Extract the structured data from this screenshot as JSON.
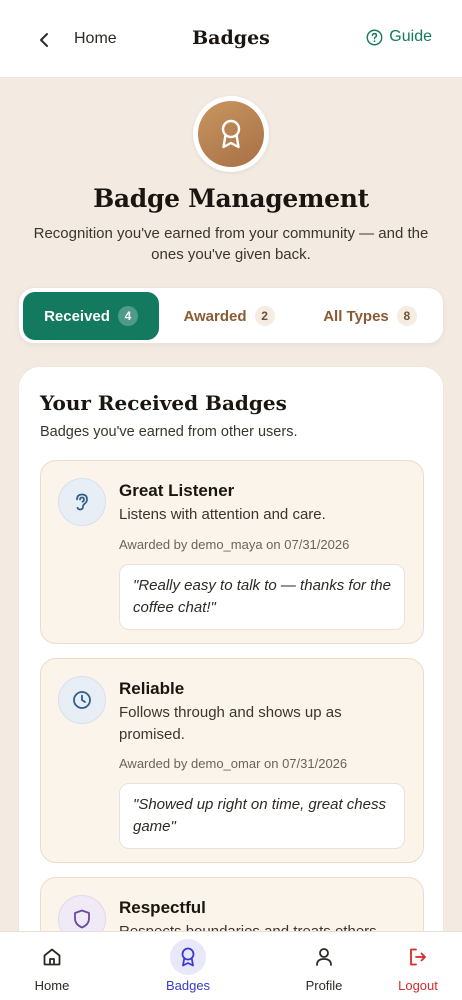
{
  "header": {
    "back_label": "Home",
    "title": "Badges",
    "guide_label": "Guide"
  },
  "hero": {
    "title": "Badge Management",
    "subtitle": "Recognition you've earned from your community — and the ones you've given back."
  },
  "tabs": [
    {
      "label": "Received",
      "count": "4",
      "active": true
    },
    {
      "label": "Awarded",
      "count": "2",
      "active": false
    },
    {
      "label": "All Types",
      "count": "8",
      "active": false
    }
  ],
  "section": {
    "title": "Your Received Badges",
    "subtitle": "Badges you've earned from other users."
  },
  "badges": [
    {
      "name": "Great Listener",
      "description": "Listens with attention and care.",
      "meta": "Awarded by demo_maya on 07/31/2026",
      "quote": "\"Really easy to talk to — thanks for the coffee chat!\"",
      "icon": "ear-icon",
      "color": "#2f5f8a"
    },
    {
      "name": "Reliable",
      "description": "Follows through and shows up as promised.",
      "meta": "Awarded by demo_omar on 07/31/2026",
      "quote": "\"Showed up right on time, great chess game\"",
      "icon": "clock-icon",
      "color": "#2f5f8a"
    },
    {
      "name": "Respectful",
      "description": "Respects boundaries and treats others",
      "icon": "shield-icon",
      "color": "#6b4aa0"
    }
  ],
  "nav": [
    {
      "label": "Home",
      "icon": "home-icon",
      "active": false
    },
    {
      "label": "Badges",
      "icon": "badge-icon",
      "active": true
    },
    {
      "label": "Profile",
      "icon": "person-icon",
      "active": false
    },
    {
      "label": "Logout",
      "icon": "logout-icon",
      "active": false
    }
  ],
  "colors": {
    "primary": "#137a5f",
    "accent_brown": "#8a5a32",
    "active_nav": "#3a3ad0",
    "logout": "#d62b2b",
    "background": "#f3ebe2"
  }
}
